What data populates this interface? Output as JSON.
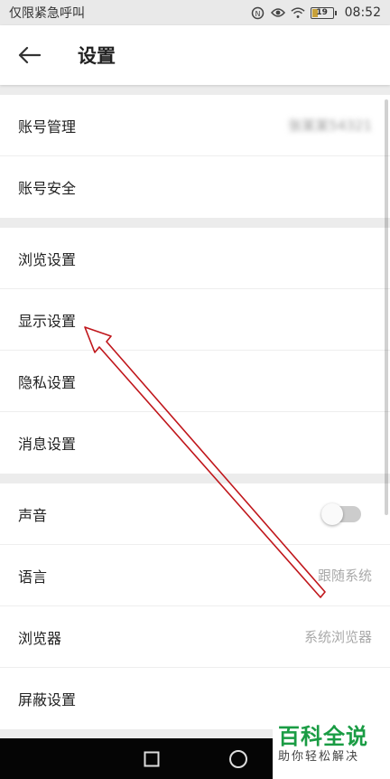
{
  "status_bar": {
    "carrier": "仅限紧急呼叫",
    "battery": "19",
    "time": "08:52"
  },
  "header": {
    "title": "设置"
  },
  "groups": [
    {
      "items": [
        {
          "label": "账号管理",
          "value": "张某某54321"
        },
        {
          "label": "账号安全"
        }
      ]
    },
    {
      "items": [
        {
          "label": "浏览设置"
        },
        {
          "label": "显示设置"
        },
        {
          "label": "隐私设置"
        },
        {
          "label": "消息设置"
        }
      ]
    },
    {
      "items": [
        {
          "label": "声音",
          "toggle_on": false
        },
        {
          "label": "语言",
          "value": "跟随系统"
        },
        {
          "label": "浏览器",
          "value": "系统浏览器"
        },
        {
          "label": "屏蔽设置"
        }
      ]
    }
  ],
  "watermark": {
    "title": "百科全说",
    "subtitle": "助你轻松解决"
  },
  "colors": {
    "annotation_arrow": "#c0161b",
    "watermark_green": "#1a9c44"
  },
  "icons": [
    "back-arrow-icon",
    "signal-icon",
    "eye-icon",
    "wifi-icon",
    "battery-icon",
    "recent-apps-icon",
    "home-icon"
  ]
}
